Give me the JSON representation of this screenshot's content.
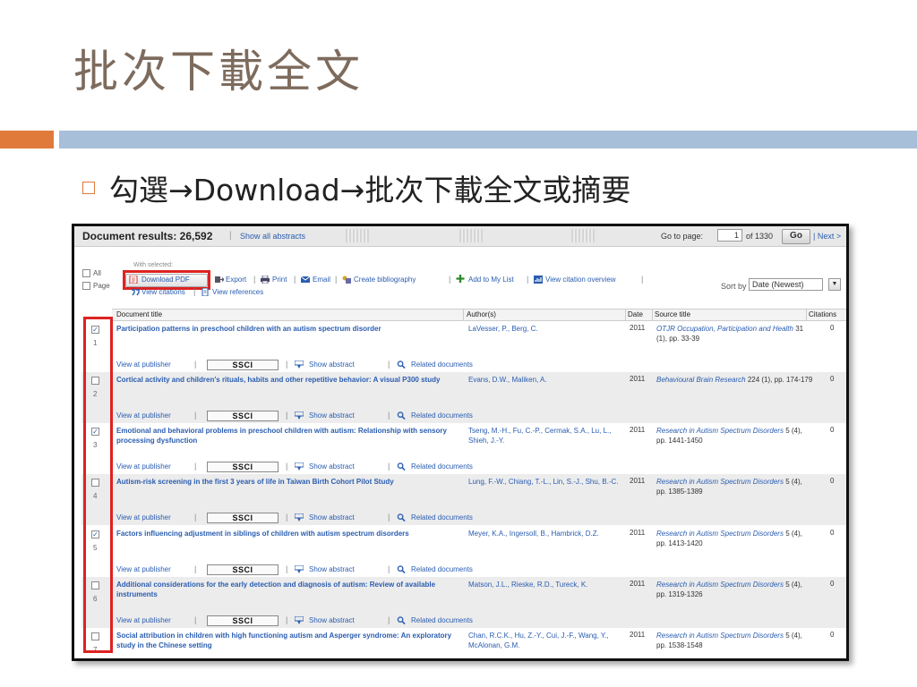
{
  "slide": {
    "title": "批次下載全文",
    "bullet": "勾選→Download→批次下載全文或摘要"
  },
  "colors": {
    "accent_orange": "#e07a3b",
    "accent_blue": "#a7bfd8",
    "highlight_red": "#dd2222",
    "link_blue": "#2a5db0"
  },
  "results": {
    "title": "Document results: 26,592",
    "show_all_abstracts": "Show all abstracts",
    "go_to_page_label": "Go to page:",
    "page_value": "1",
    "page_of": "of 1330",
    "go_button": "Go",
    "next_link": "Next >"
  },
  "toolbar": {
    "all_label": "All",
    "page_label": "Page",
    "with_selected": "With selected:",
    "download_pdf": "Download PDF",
    "export": "Export",
    "print": "Print",
    "email": "Email",
    "create_bibliography": "Create bibliography",
    "add_to_my_list": "Add to My List",
    "view_citation_overview": "View citation overview",
    "view_citations": "View citations",
    "view_references": "View references",
    "sort_by_label": "Sort by",
    "sort_value": "Date (Newest)"
  },
  "columns": [
    "Document title",
    "Author(s)",
    "Date",
    "Source title",
    "Citations"
  ],
  "row_links": {
    "view_at_publisher": "View at publisher",
    "ssci": "SSCI",
    "show_abstract": "Show abstract",
    "related_documents": "Related documents"
  },
  "rows": [
    {
      "num": "1",
      "checked": true,
      "title": "Participation patterns in preschool children with an autism spectrum disorder",
      "authors": "LaVesser, P., Berg, C.",
      "date": "2011",
      "source_italic": "OTJR Occupation, Participation and Health",
      "source_rest": " 31 (1), pp. 33-39",
      "citations": "0"
    },
    {
      "num": "2",
      "checked": false,
      "title": "Cortical activity and children's rituals, habits and other repetitive behavior: A visual P300 study",
      "authors": "Evans, D.W., Maliken, A.",
      "date": "2011",
      "source_italic": "Behavioural Brain Research",
      "source_rest": " 224 (1), pp. 174-179",
      "citations": "0"
    },
    {
      "num": "3",
      "checked": true,
      "title": "Emotional and behavioral problems in preschool children with autism: Relationship with sensory processing dysfunction",
      "authors": "Tseng, M.-H., Fu, C.-P., Cermak, S.A., Lu, L., Shieh, J.-Y.",
      "date": "2011",
      "source_italic": "Research in Autism Spectrum Disorders",
      "source_rest": " 5 (4), pp. 1441-1450",
      "citations": "0"
    },
    {
      "num": "4",
      "checked": false,
      "title": "Autism-risk screening in the first 3 years of life in Taiwan Birth Cohort Pilot Study",
      "authors": "Lung, F.-W., Chiang, T.-L., Lin, S.-J., Shu, B.-C.",
      "date": "2011",
      "source_italic": "Research in Autism Spectrum Disorders",
      "source_rest": " 5 (4), pp. 1385-1389",
      "citations": "0"
    },
    {
      "num": "5",
      "checked": true,
      "title": "Factors influencing adjustment in siblings of children with autism spectrum disorders",
      "authors": "Meyer, K.A., Ingersoll, B., Hambrick, D.Z.",
      "date": "2011",
      "source_italic": "Research in Autism Spectrum Disorders",
      "source_rest": " 5 (4), pp. 1413-1420",
      "citations": "0"
    },
    {
      "num": "6",
      "checked": false,
      "title": "Additional considerations for the early detection and diagnosis of autism: Review of available instruments",
      "authors": "Matson, J.L., Rieske, R.D., Tureck, K.",
      "date": "2011",
      "source_italic": "Research in Autism Spectrum Disorders",
      "source_rest": " 5 (4), pp. 1319-1326",
      "citations": "0"
    },
    {
      "num": "7",
      "checked": false,
      "title": "Social attribution in children with high functioning autism and Asperger syndrome: An exploratory study in the Chinese setting",
      "authors": "Chan, R.C.K., Hu, Z.-Y., Cui, J.-F., Wang, Y., McAlonan, G.M.",
      "date": "2011",
      "source_italic": "Research in Autism Spectrum Disorders",
      "source_rest": " 5 (4), pp. 1538-1548",
      "citations": "0"
    }
  ]
}
